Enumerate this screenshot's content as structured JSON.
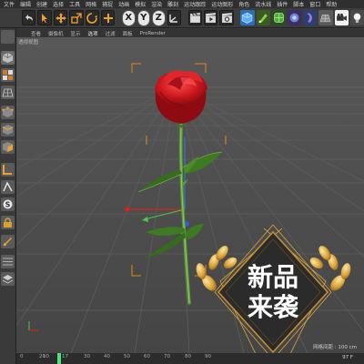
{
  "menu": {
    "items": [
      "文件",
      "编辑",
      "创建",
      "选择",
      "工具",
      "网格",
      "捕捉",
      "动画",
      "模拟",
      "渲染",
      "雕刻",
      "运动跟踪",
      "运动图形",
      "角色",
      "流水线",
      "插件",
      "脚本",
      "窗口",
      "帮助"
    ]
  },
  "toolbar": {
    "axis_x": "X",
    "axis_y": "Y",
    "axis_z": "Z"
  },
  "viewport": {
    "tabs": [
      "查看",
      "摄像机",
      "显示",
      "选项",
      "过滤",
      "面板",
      "ProRender"
    ],
    "active_tab": "选项",
    "view_name": "透视视图",
    "grid_scale": "网格间距 : 100 cm"
  },
  "timeline": {
    "ticks": [
      "0",
      "10",
      "20",
      "30",
      "40",
      "50",
      "60",
      "70",
      "80",
      "90"
    ],
    "current_frame": "17",
    "end_frame": "97 F"
  },
  "badge": {
    "line1": "新品",
    "line2": "来袭"
  },
  "colors": {
    "rose_red": "#c8151b",
    "stem_green": "#5c9a3a",
    "badge_bg": "#2b2b2b",
    "badge_gold": "#d9a43a",
    "selection_orange": "#e08a18",
    "playhead_green": "#4fe07a"
  }
}
